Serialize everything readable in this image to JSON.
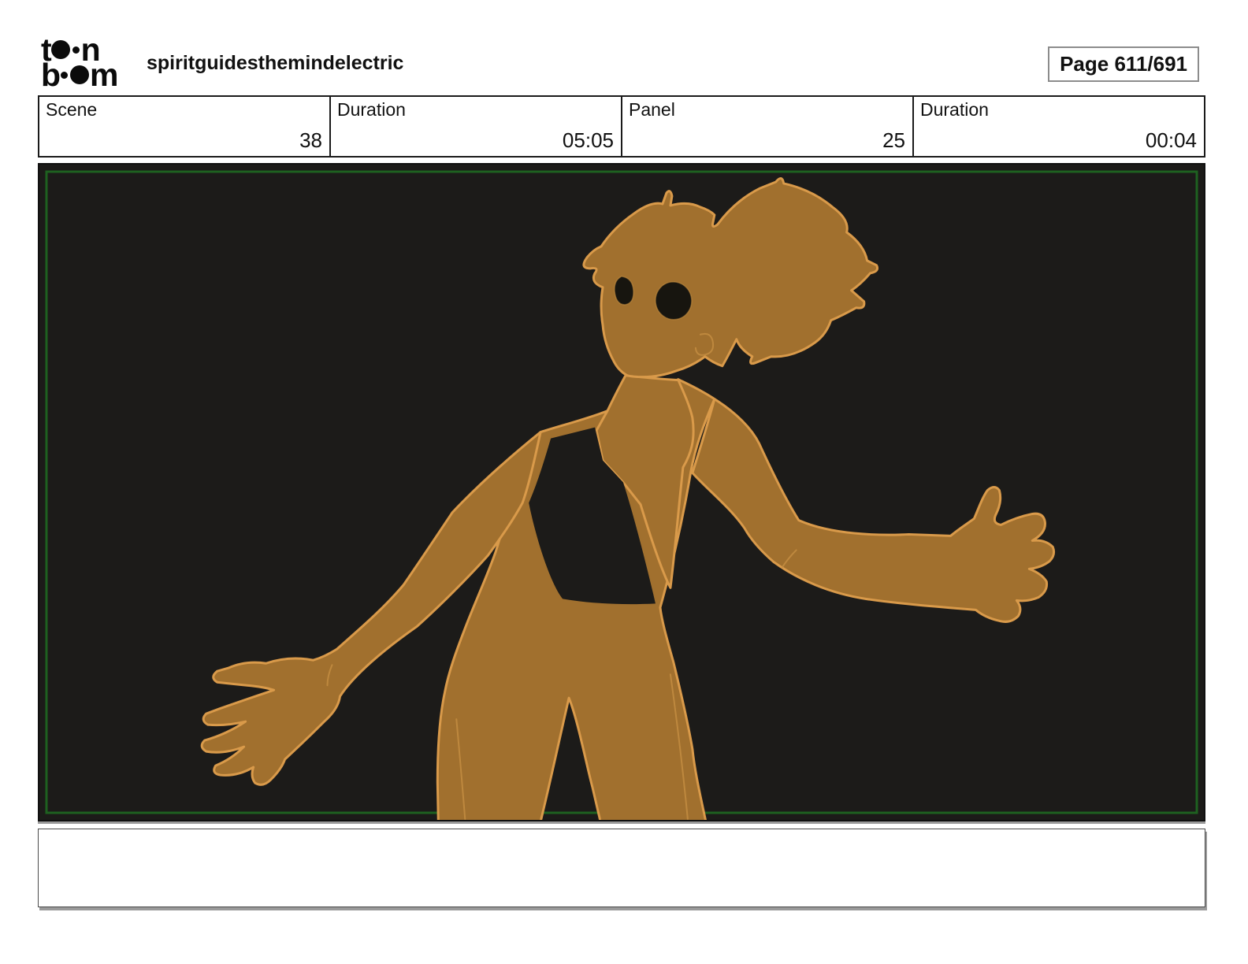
{
  "header": {
    "logo": {
      "l1a": "t",
      "l1b": "n",
      "l2a": "b",
      "l2b": "m"
    },
    "title": "spiritguidesthemindelectric",
    "page_badge": "Page 611/691"
  },
  "info_row": {
    "cells": [
      {
        "label": "Scene",
        "value": "38"
      },
      {
        "label": "Duration",
        "value": "05:05"
      },
      {
        "label": "Panel",
        "value": "25"
      },
      {
        "label": "Duration",
        "value": "00:04"
      }
    ]
  },
  "panel": {
    "background_color": "#1c1b19",
    "safe_frame_color": "#1e6120",
    "figure_fill_color": "#a1702e",
    "figure_outline_color": "#d99a4a",
    "eye_color": "#17150f",
    "description": "orange-brown silhouette of a character with ponytail, arms spread, legs cropped at frame bottom"
  },
  "caption": {
    "text": ""
  }
}
